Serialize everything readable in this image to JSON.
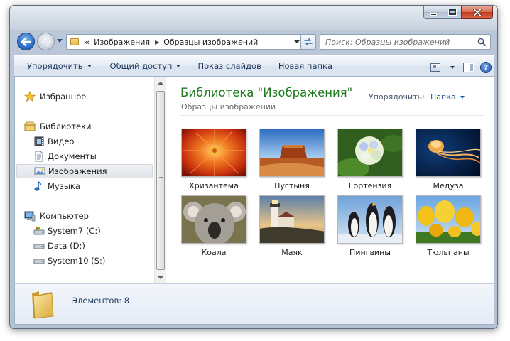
{
  "window": {
    "buttons": {
      "minimize": "minimize-icon",
      "maximize": "maximize-icon",
      "close": "close-icon"
    }
  },
  "address": {
    "overflow": "«",
    "segments": [
      "Изображения",
      "Образцы изображений"
    ],
    "separator": "▶"
  },
  "search": {
    "placeholder": "Поиск: Образцы изображений"
  },
  "toolbar": {
    "organize": "Упорядочить",
    "share": "Общий доступ",
    "slideshow": "Показ слайдов",
    "new_folder": "Новая папка"
  },
  "nav": {
    "favorites": "Избранное",
    "libraries": "Библиотеки",
    "video": "Видео",
    "documents": "Документы",
    "pictures": "Изображения",
    "music": "Музыка",
    "computer": "Компьютер",
    "drive_c": "System7 (C:)",
    "drive_d": "Data (D:)",
    "drive_s": "System10 (S:)"
  },
  "library": {
    "title": "Библиотека \"Изображения\"",
    "subtitle": "Образцы изображений",
    "arrange_label": "Упорядочить:",
    "arrange_value": "Папка"
  },
  "items": [
    {
      "label": "Хризантема"
    },
    {
      "label": "Пустыня"
    },
    {
      "label": "Гортензия"
    },
    {
      "label": "Медуза"
    },
    {
      "label": "Коала"
    },
    {
      "label": "Маяк"
    },
    {
      "label": "Пингвины"
    },
    {
      "label": "Тюльпаны"
    }
  ],
  "details": {
    "count": "Элементов: 8"
  },
  "colors": {
    "library_title": "#1e7a1e",
    "link": "#1e5aa8",
    "close_button": "#c4381a"
  }
}
